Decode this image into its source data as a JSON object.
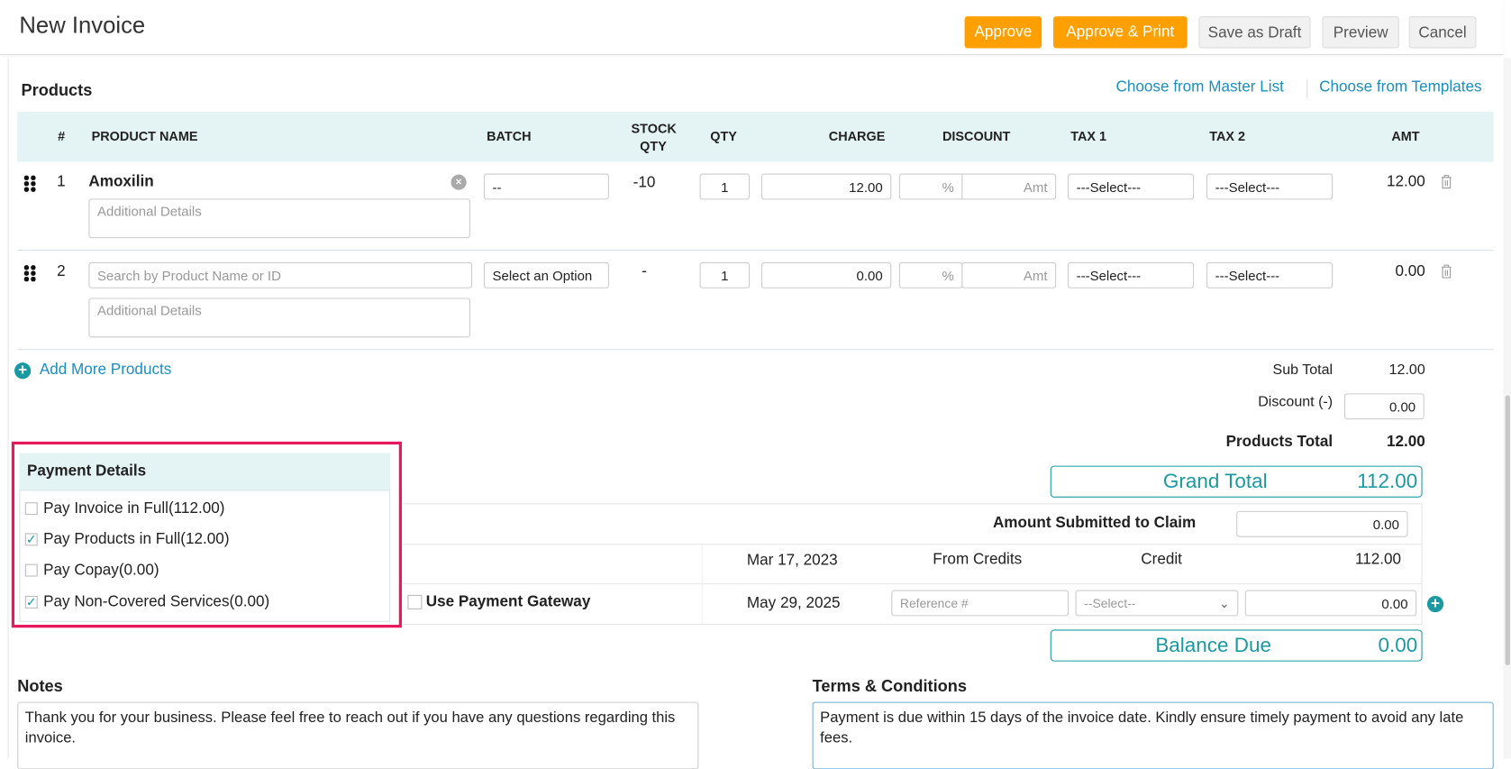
{
  "header": {
    "title": "New Invoice",
    "buttons": {
      "approve": "Approve",
      "approve_print": "Approve & Print",
      "save_draft": "Save as Draft",
      "preview": "Preview",
      "cancel": "Cancel"
    }
  },
  "products": {
    "title": "Products",
    "links": {
      "master": "Choose from Master List",
      "templates": "Choose from Templates"
    },
    "columns": {
      "num": "#",
      "name": "PRODUCT NAME",
      "batch": "BATCH",
      "stock1": "STOCK",
      "stock2": "QTY",
      "qty": "QTY",
      "charge": "CHARGE",
      "discount": "DISCOUNT",
      "tax1": "TAX 1",
      "tax2": "TAX 2",
      "amt": "AMT"
    },
    "rows": [
      {
        "num": "1",
        "name": "Amoxilin",
        "details_placeholder": "Additional Details",
        "batch": "--",
        "stock": "-10",
        "qty": "1",
        "charge": "12.00",
        "disc_pct": "%",
        "disc_amt": "Amt",
        "tax1": "---Select---",
        "tax2": "---Select---",
        "amt": "12.00"
      },
      {
        "num": "2",
        "name_placeholder": "Search by Product Name or ID",
        "details_placeholder": "Additional Details",
        "batch": "Select an Option",
        "stock": "-",
        "qty": "1",
        "charge": "0.00",
        "disc_pct": "%",
        "disc_amt": "Amt",
        "tax1": "---Select---",
        "tax2": "---Select---",
        "amt": "0.00"
      }
    ],
    "add_more": "Add More Products"
  },
  "totals": {
    "subtotal_label": "Sub Total",
    "subtotal": "12.00",
    "discount_label": "Discount (-)",
    "discount": "0.00",
    "products_total_label": "Products Total",
    "products_total": "12.00",
    "grand_total_label": "Grand Total",
    "grand_total": "112.00",
    "balance_label": "Balance Due",
    "balance": "0.00"
  },
  "payment_details": {
    "title": "Payment Details",
    "options": [
      {
        "label": "Pay Invoice in Full(112.00)",
        "checked": false
      },
      {
        "label": "Pay Products in Full(12.00)",
        "checked": true
      },
      {
        "label": "Pay Copay(0.00)",
        "checked": false
      },
      {
        "label": "Pay Non-Covered Services(0.00)",
        "checked": true
      }
    ]
  },
  "payments": {
    "claim_label": "Amount Submitted to Claim",
    "claim_value": "0.00",
    "credit_row": {
      "date": "Mar 17, 2023",
      "source": "From Credits",
      "method": "Credit",
      "amount": "112.00"
    },
    "new_row": {
      "gateway_label": "Use Payment Gateway",
      "date": "May 29, 2025",
      "reference_placeholder": "Reference #",
      "method": "--Select--",
      "amount": "0.00"
    }
  },
  "notes": {
    "label": "Notes",
    "text": "Thank you for your business. Please feel free to reach out if you have any questions regarding this invoice."
  },
  "terms": {
    "label": "Terms & Conditions",
    "text": "Payment is due within 15 days of the invoice date. Kindly ensure timely payment to avoid any late fees."
  }
}
